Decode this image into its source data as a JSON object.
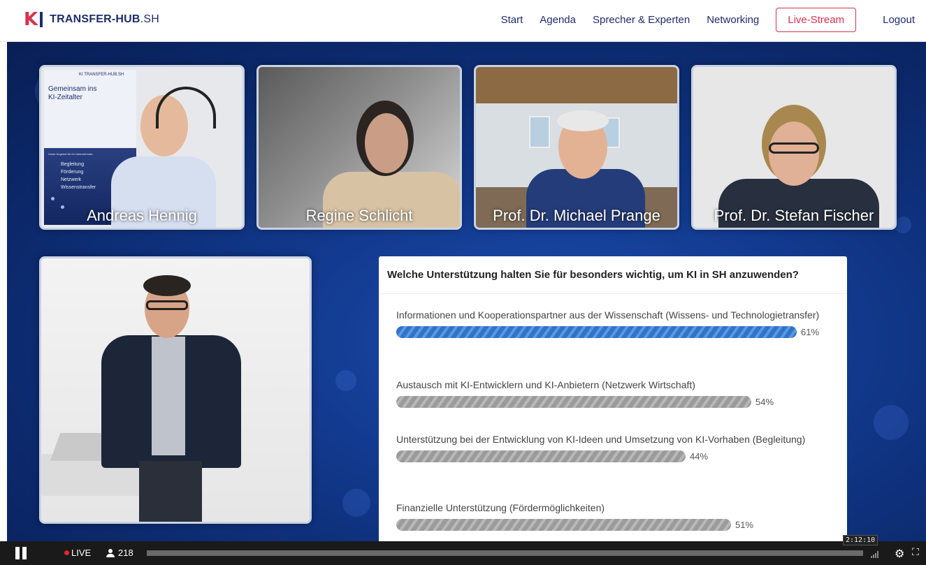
{
  "brand": {
    "logo_mark": "KI",
    "name": "TRANSFER-HUB",
    "suffix": ".SH"
  },
  "nav": {
    "items": [
      "Start",
      "Agenda",
      "Sprecher & Experten",
      "Networking"
    ],
    "live_label": "Live-Stream",
    "logout_label": "Logout"
  },
  "participants": [
    {
      "name": "Andreas Hennig"
    },
    {
      "name": "Regine Schlicht"
    },
    {
      "name": "Prof. Dr. Michael Prange"
    },
    {
      "name": "Prof. Dr. Stefan Fischer"
    }
  ],
  "banner": {
    "logo": "KI TRANSFER-HUB.SH",
    "headline_1": "Gemeinsam ins",
    "headline_2": "KI-Zeitalter",
    "intro": "Unser Angebot für Ihr Unternehmen:",
    "bullets": [
      "Begleitung",
      "Förderung",
      "Netzwerk",
      "Wissenstransfer"
    ]
  },
  "poll": {
    "question": "Welche Unterstützung halten Sie für besonders wichtig, um KI in SH anzuwenden?",
    "options": [
      {
        "label": "Informationen und Kooperationspartner aus der Wissenschaft (Wissens- und Technologietransfer)",
        "percent": 61,
        "pct_label": "61%",
        "leading": true
      },
      {
        "label": "Austausch mit KI-Entwicklern und KI-Anbietern (Netzwerk Wirtschaft)",
        "percent": 54,
        "pct_label": "54%",
        "leading": false
      },
      {
        "label": "Unterstützung bei der Entwicklung von KI-Ideen und Umsetzung von KI-Vorhaben (Begleitung)",
        "percent": 44,
        "pct_label": "44%",
        "leading": false
      },
      {
        "label": "Finanzielle Unterstützung (Fördermöglichkeiten)",
        "percent": 51,
        "pct_label": "51%",
        "leading": false
      }
    ]
  },
  "player": {
    "live_label": "LIVE",
    "viewer_count": "218",
    "timestamp": "2:12:10",
    "progress": 1.0,
    "icons": {
      "play_pause": "pause-icon",
      "viewers": "user-icon",
      "quality": "signal-icon",
      "settings": "gear-icon",
      "fullscreen": "fullscreen-icon"
    }
  },
  "colors": {
    "brand_red": "#d6334e",
    "brand_navy": "#1f2d6b",
    "stage_blue": "#123a8f",
    "poll_leader": "#2f74c8",
    "poll_bar": "#9b9b9b"
  }
}
